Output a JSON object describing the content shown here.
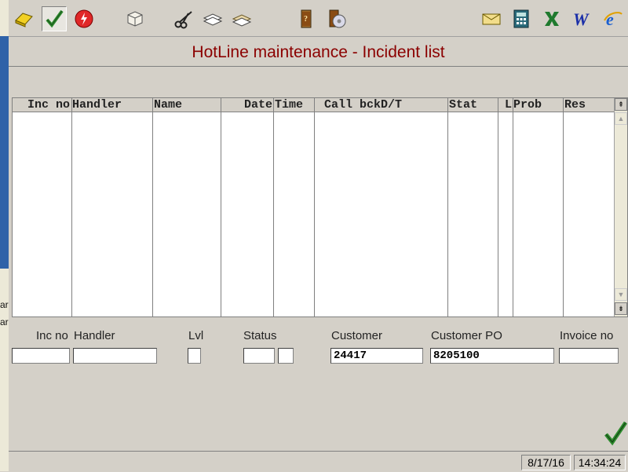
{
  "left_fragments": [
    "ar",
    "ar"
  ],
  "toolbar": {
    "buttons": [
      {
        "name": "open-folder-icon"
      },
      {
        "name": "checkmark-icon"
      },
      {
        "name": "stop-icon"
      },
      {
        "name": "package-icon"
      },
      {
        "name": "scissors-icon"
      },
      {
        "name": "copy-icon"
      },
      {
        "name": "paste-icon"
      },
      {
        "name": "book-icon"
      },
      {
        "name": "book-disc-icon"
      },
      {
        "name": "mail-icon"
      },
      {
        "name": "calculator-icon"
      },
      {
        "name": "excel-icon"
      },
      {
        "name": "word-icon"
      },
      {
        "name": "internet-explorer-icon"
      }
    ]
  },
  "title": "HotLine maintenance - Incident list",
  "table": {
    "columns": [
      "Inc no",
      "Handler",
      "Name",
      "Date",
      "Time",
      "Call bckD/T",
      "Stat",
      "L",
      "Prob",
      "Res"
    ],
    "rows": []
  },
  "filters": {
    "inc_no": {
      "label": "Inc no",
      "value": ""
    },
    "handler": {
      "label": "Handler",
      "value": ""
    },
    "lvl": {
      "label": "Lvl",
      "value": ""
    },
    "status": {
      "label": "Status",
      "value": ""
    },
    "status2": {
      "value": ""
    },
    "customer": {
      "label": "Customer",
      "value": "24417"
    },
    "customer_po": {
      "label": "Customer PO",
      "value": "8205100"
    },
    "invoice_no": {
      "label": "Invoice no",
      "value": ""
    }
  },
  "status": {
    "date": "8/17/16",
    "time": "14:34:24"
  },
  "colors": {
    "title": "#8b0000",
    "background": "#d4d0c8",
    "left_strip": "#2f62a8"
  }
}
